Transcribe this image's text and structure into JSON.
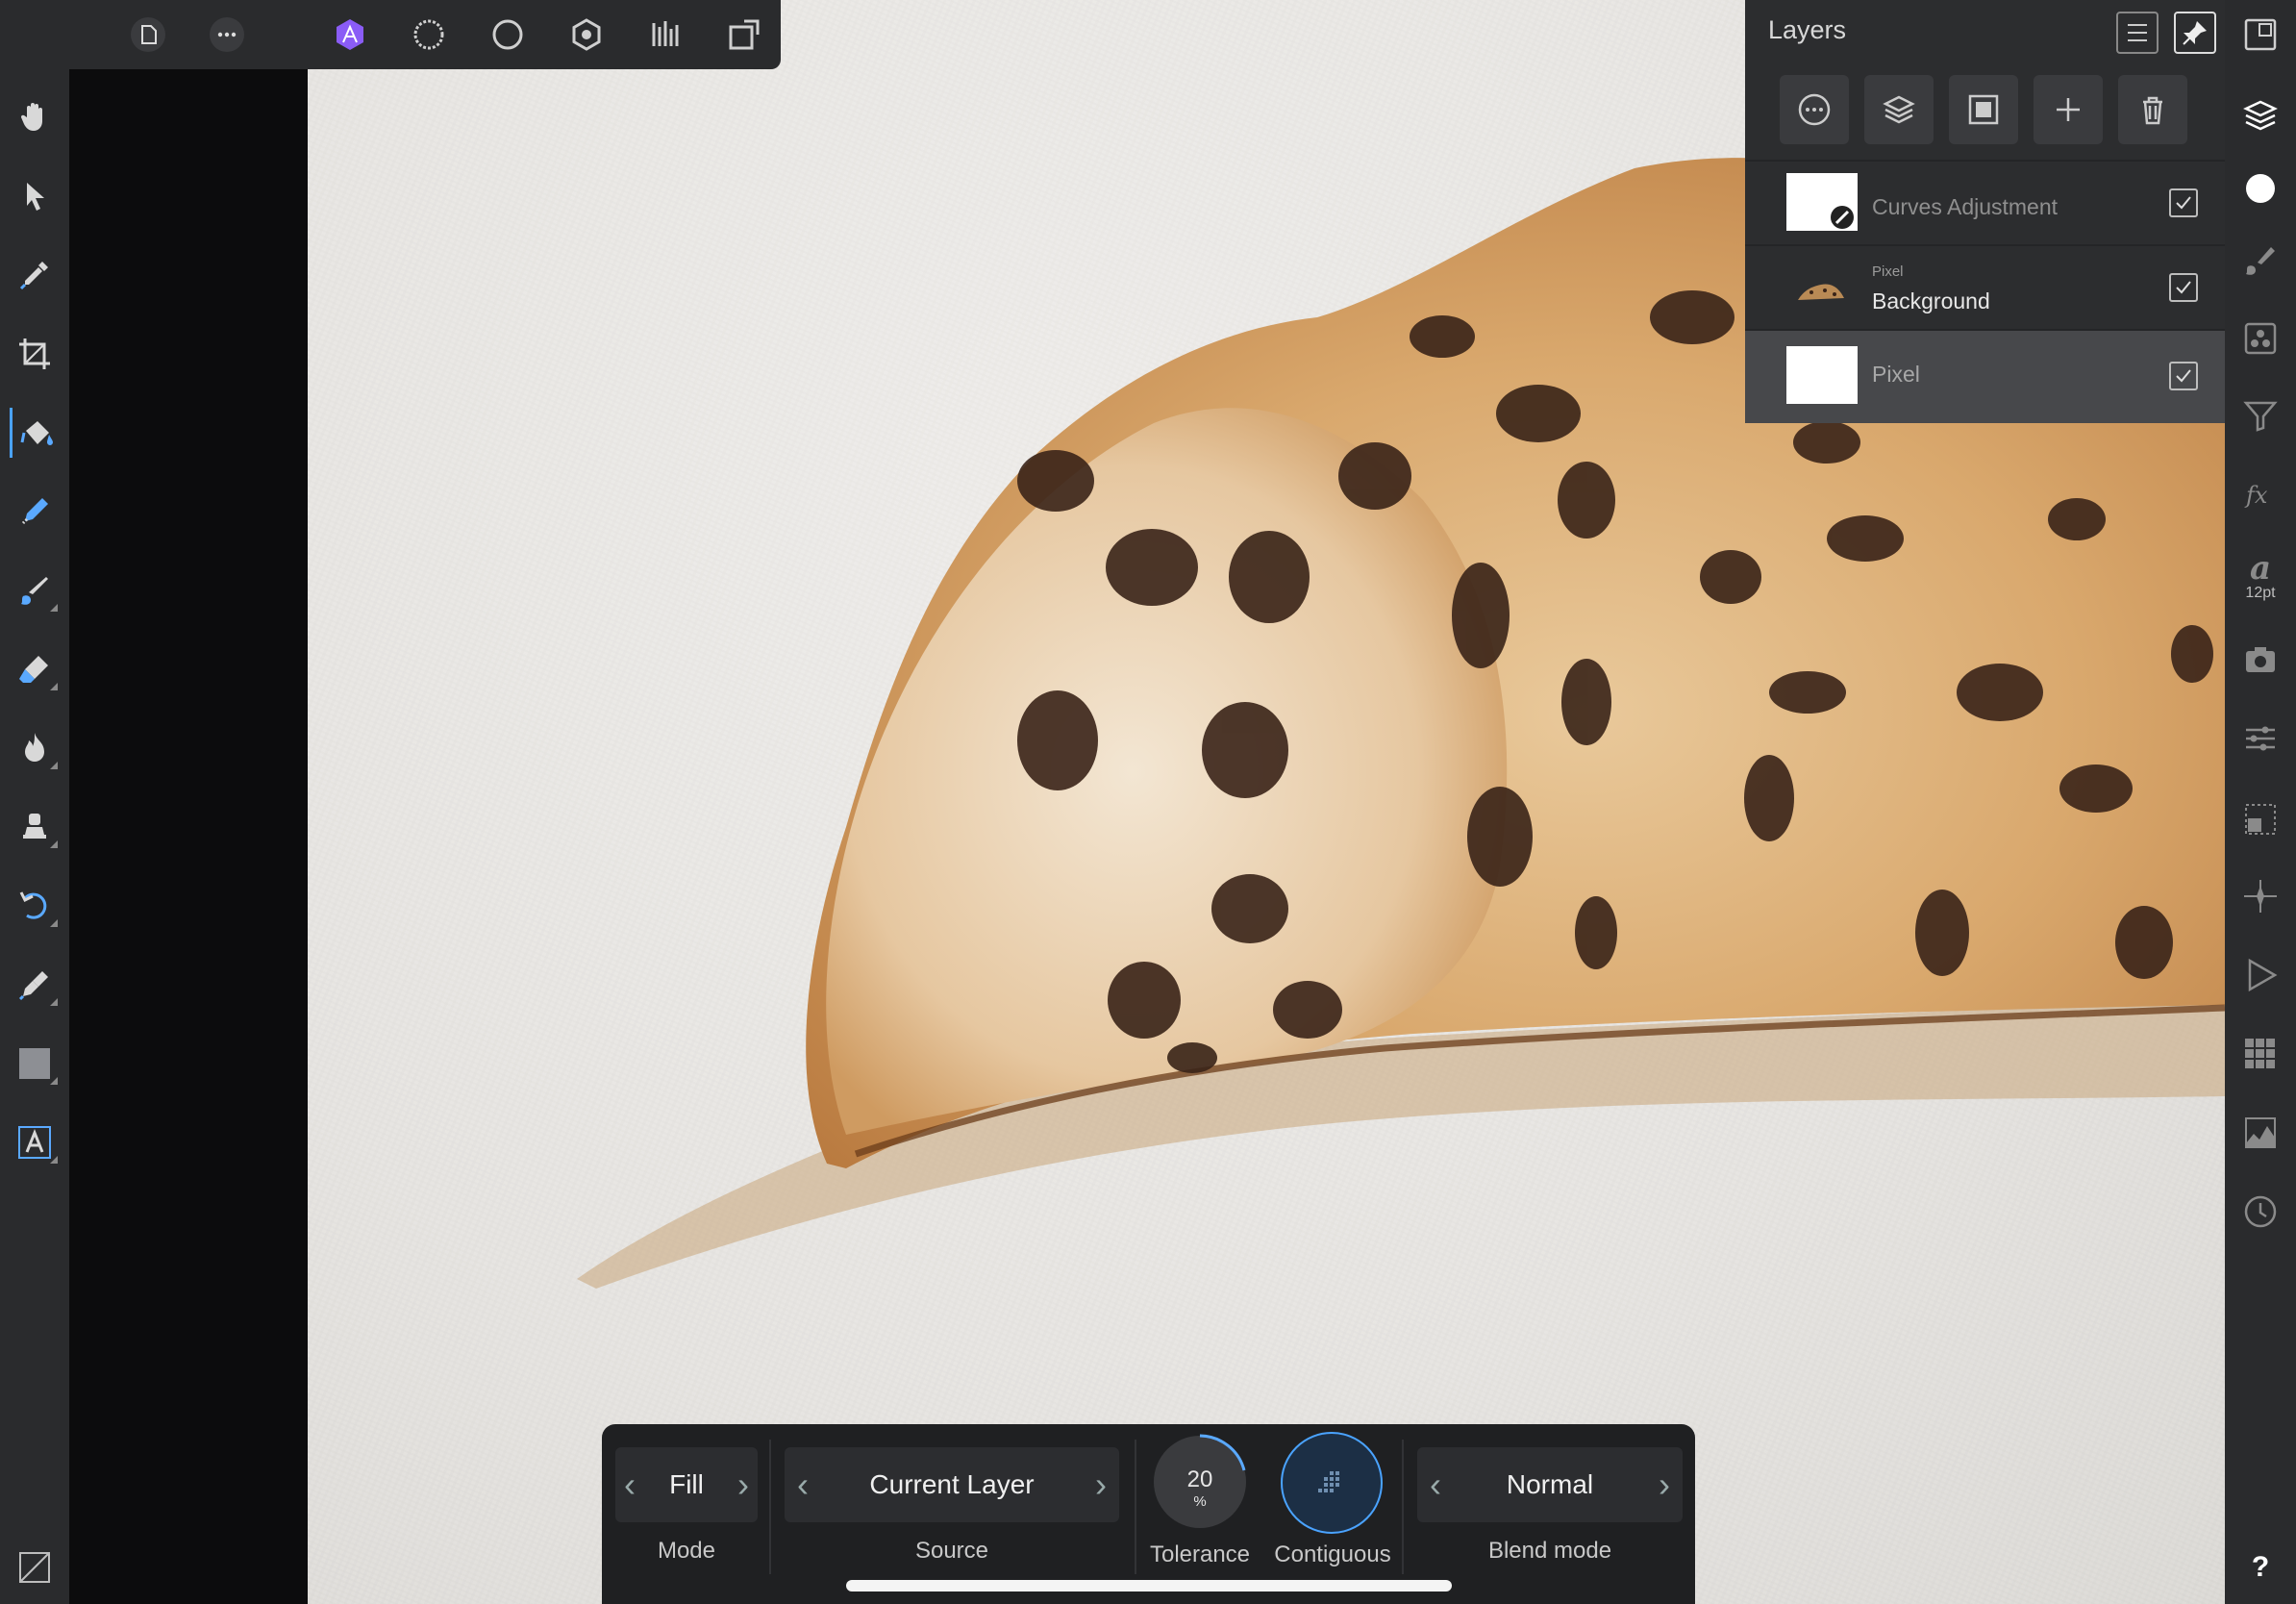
{
  "top_toolbar": {
    "icons": [
      "back-arrow-icon",
      "document-icon",
      "more-icon",
      "photo-persona-icon",
      "liquify-persona-icon",
      "develop-persona-icon",
      "tone-mapping-persona-icon",
      "levels-icon",
      "export-persona-icon"
    ],
    "accent": "#8a5cf6"
  },
  "left_toolbar": {
    "tools": [
      "view-tool",
      "move-tool",
      "color-picker-tool",
      "crop-tool",
      "flood-fill-tool",
      "selection-brush-tool",
      "paint-brush-tool",
      "erase-brush-tool",
      "burn-brush-tool",
      "clone-brush-tool",
      "undo-brush-tool",
      "pen-tool",
      "rectangle-tool",
      "artistic-text-tool",
      "quick-menu"
    ],
    "active_tool": "flood-fill-tool"
  },
  "right_toolbar": {
    "studios": [
      "navigator-studio",
      "layers-studio",
      "color-studio",
      "brushes-studio",
      "channels-studio",
      "adjustments-studio",
      "effects-studio",
      "text-studio",
      "stock-studio",
      "adjust-studio",
      "transform-studio",
      "snapping-studio",
      "macro-studio",
      "swatches-studio",
      "histogram-studio",
      "history-studio"
    ],
    "text_size_label": "12pt",
    "help_label": "?"
  },
  "layers_panel": {
    "title": "Layers",
    "buttons": [
      "layer-options",
      "layer-stack",
      "mask",
      "add-layer",
      "delete-layer"
    ],
    "layers": [
      {
        "kind": "",
        "name": "Curves Adjustment",
        "visible": true
      },
      {
        "kind": "Pixel",
        "name": "Background",
        "visible": true
      },
      {
        "kind": "",
        "name": "Pixel",
        "visible": true
      }
    ]
  },
  "context_toolbar": {
    "mode": {
      "value": "Fill",
      "label": "Mode"
    },
    "source": {
      "value": "Current Layer",
      "label": "Source"
    },
    "tolerance": {
      "value": "20",
      "unit": "%",
      "label": "Tolerance"
    },
    "contiguous": {
      "label": "Contiguous"
    },
    "blend_mode": {
      "value": "Normal",
      "label": "Blend mode"
    }
  }
}
